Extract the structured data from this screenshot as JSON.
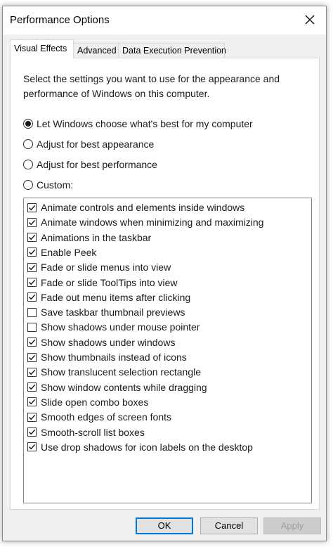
{
  "window": {
    "title": "Performance Options",
    "close_label": "✕"
  },
  "tabs": [
    {
      "label": "Visual Effects",
      "active": true
    },
    {
      "label": "Advanced",
      "active": false
    },
    {
      "label": "Data Execution Prevention",
      "active": false
    }
  ],
  "description": "Select the settings you want to use for the appearance and performance of Windows on this computer.",
  "radios": [
    {
      "label": "Let Windows choose what's best for my computer",
      "checked": true
    },
    {
      "label": "Adjust for best appearance",
      "checked": false
    },
    {
      "label": "Adjust for best performance",
      "checked": false
    },
    {
      "label": "Custom:",
      "checked": false
    }
  ],
  "effects": [
    {
      "label": "Animate controls and elements inside windows",
      "checked": true
    },
    {
      "label": "Animate windows when minimizing and maximizing",
      "checked": true
    },
    {
      "label": "Animations in the taskbar",
      "checked": true
    },
    {
      "label": "Enable Peek",
      "checked": true
    },
    {
      "label": "Fade or slide menus into view",
      "checked": true
    },
    {
      "label": "Fade or slide ToolTips into view",
      "checked": true
    },
    {
      "label": "Fade out menu items after clicking",
      "checked": true
    },
    {
      "label": "Save taskbar thumbnail previews",
      "checked": false
    },
    {
      "label": "Show shadows under mouse pointer",
      "checked": false
    },
    {
      "label": "Show shadows under windows",
      "checked": true
    },
    {
      "label": "Show thumbnails instead of icons",
      "checked": true
    },
    {
      "label": "Show translucent selection rectangle",
      "checked": true
    },
    {
      "label": "Show window contents while dragging",
      "checked": true
    },
    {
      "label": "Slide open combo boxes",
      "checked": true
    },
    {
      "label": "Smooth edges of screen fonts",
      "checked": true
    },
    {
      "label": "Smooth-scroll list boxes",
      "checked": true
    },
    {
      "label": "Use drop shadows for icon labels on the desktop",
      "checked": true
    }
  ],
  "buttons": {
    "ok": "OK",
    "cancel": "Cancel",
    "apply": "Apply"
  },
  "colors": {
    "accent": "#0078d7",
    "dialog_bg": "#f0f0f0"
  }
}
